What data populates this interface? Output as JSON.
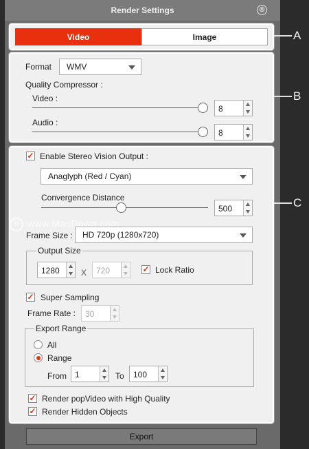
{
  "window": {
    "title": "Render Settings",
    "close_icon": "⊗"
  },
  "tabs": [
    {
      "label": "Video",
      "active": true
    },
    {
      "label": "Image",
      "active": false
    }
  ],
  "callouts": {
    "a": "A",
    "b": "B",
    "c": "C"
  },
  "section_b": {
    "format_label": "Format",
    "format_value": "WMV",
    "quality_label": "Quality Compressor :",
    "video_label": "Video :",
    "video_value": "8",
    "audio_label": "Audio :",
    "audio_value": "8"
  },
  "section_c": {
    "stereo_label": "Enable Stereo Vision Output :",
    "stereo_checked": true,
    "stereo_mode": "Anaglyph (Red / Cyan)",
    "convergence_label": "Convergence Distance",
    "convergence_value": "500",
    "frame_size_label": "Frame Size :",
    "frame_size_value": "HD 720p (1280x720)",
    "output_size_label": "Output Size",
    "width_value": "1280",
    "x_label": "X",
    "height_value": "720",
    "lock_ratio_label": "Lock Ratio",
    "lock_ratio_checked": true,
    "super_sampling_label": "Super Sampling",
    "super_sampling_checked": true,
    "frame_rate_label": "Frame Rate :",
    "frame_rate_value": "30",
    "export_range_label": "Export Range",
    "all_label": "All",
    "range_label": "Range",
    "range_selected": true,
    "from_label": "From",
    "from_value": "1",
    "to_label": "To",
    "to_value": "100",
    "popvideo_label": "Render popVideo with High Quality",
    "popvideo_checked": true,
    "hidden_objects_label": "Render Hidden Objects",
    "hidden_objects_checked": true
  },
  "export_label": "Export",
  "watermark": {
    "text": "www.MacDown.com",
    "logo": "M"
  },
  "colors": {
    "accent": "#e8300e",
    "panel": "#f0f0f0",
    "background": "#2b2b2b"
  }
}
